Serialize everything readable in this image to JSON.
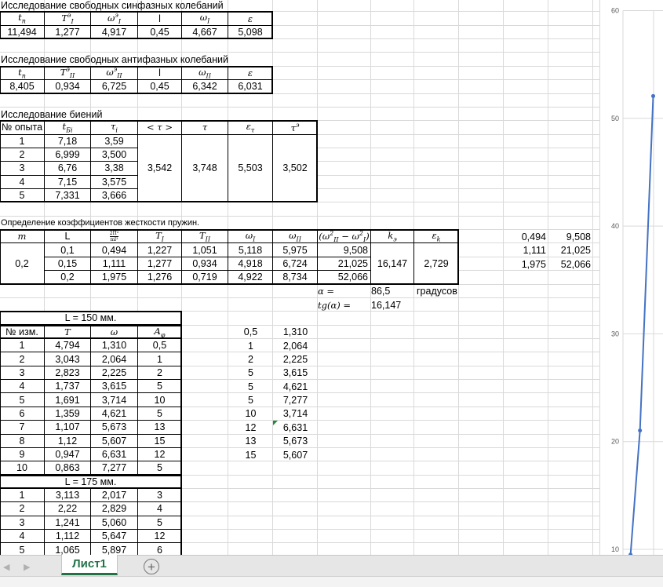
{
  "sync": {
    "title": "Исследование свободных синфазных колебаний",
    "headers": [
      {
        "t": "t",
        "sub": "n"
      },
      {
        "t": "T",
        "sub": "I",
        "sup": "э"
      },
      {
        "t": "ω",
        "sub": "I",
        "sup": "э"
      },
      {
        "plain": "l"
      },
      {
        "t": "ω",
        "sub": "I"
      },
      {
        "t": "ε"
      }
    ],
    "values": [
      "11,494",
      "1,277",
      "4,917",
      "0,45",
      "4,667",
      "5,098"
    ]
  },
  "anti": {
    "title": "Исследование свободных антифазных колебаний",
    "headers": [
      {
        "t": "t",
        "sub": "n"
      },
      {
        "t": "T",
        "sub": "II",
        "sup": "э"
      },
      {
        "t": "ω",
        "sub": "II",
        "sup": "э"
      },
      {
        "plain": "l"
      },
      {
        "t": "ω",
        "sub": "II"
      },
      {
        "t": "ε"
      }
    ],
    "values": [
      "8,405",
      "0,934",
      "6,725",
      "0,45",
      "6,342",
      "6,031"
    ]
  },
  "beats": {
    "title": "Исследование биений",
    "headers": [
      {
        "plain": "№ опыта"
      },
      {
        "t": "t",
        "sub": "Бi"
      },
      {
        "t": "τ",
        "sub": "i"
      },
      {
        "t": "< τ >"
      },
      {
        "t": "τ"
      },
      {
        "t": "ε",
        "sub": "τ"
      },
      {
        "t": "τ",
        "sup": "э"
      }
    ],
    "rows": [
      [
        "1",
        "7,18",
        "3,59"
      ],
      [
        "2",
        "6,999",
        "3,500"
      ],
      [
        "3",
        "6,76",
        "3,38"
      ],
      [
        "4",
        "7,15",
        "3,575"
      ],
      [
        "5",
        "7,331",
        "3,666"
      ]
    ],
    "summary": [
      "3,542",
      "3,748",
      "5,503",
      "3,502"
    ]
  },
  "stiffness": {
    "title": "Определение коэффициентов жесткости пружин.",
    "headers": [
      {
        "t": "m"
      },
      {
        "plain": "L"
      },
      {
        "num": "2Π²",
        "den": "ml²"
      },
      {
        "t": "T",
        "sub": "I"
      },
      {
        "t": "T",
        "sub": "II"
      },
      {
        "t": "ω",
        "sub": "I"
      },
      {
        "t": "ω",
        "sub": "II"
      },
      {
        "t": "(ω",
        "sup": "2",
        "sub": "II",
        "t2": " − ω",
        "sup2": "2",
        "sub2": "I",
        "t3": ")"
      },
      {
        "t": "k",
        "sub": "э"
      },
      {
        "t": "ε",
        "sub": "k"
      }
    ],
    "m": "0,2",
    "rows": [
      [
        "0,1",
        "0,494",
        "1,227",
        "1,051",
        "5,118",
        "5,975",
        "9,508"
      ],
      [
        "0,15",
        "1,111",
        "1,277",
        "0,934",
        "4,918",
        "6,724",
        "21,025"
      ],
      [
        "0,2",
        "1,975",
        "1,276",
        "0,719",
        "4,922",
        "8,734",
        "52,066"
      ]
    ],
    "k": "16,147",
    "eps_k": "2,729",
    "alpha_label": "α =",
    "alpha_value": "86,5",
    "alpha_unit": "градусов",
    "tg_label": "tg(α) =",
    "tg_value": "16,147",
    "side": [
      [
        "0,494",
        "9,508"
      ],
      [
        "1,111",
        "21,025"
      ],
      [
        "1,975",
        "52,066"
      ]
    ]
  },
  "l150": {
    "title": "L = 150 мм.",
    "headers": [
      {
        "plain": "№ изм."
      },
      {
        "t": "T"
      },
      {
        "t": "ω"
      },
      {
        "t": "A",
        "sub": "φ"
      }
    ],
    "rows": [
      [
        "1",
        "4,794",
        "1,310",
        "0,5"
      ],
      [
        "2",
        "3,043",
        "2,064",
        "1"
      ],
      [
        "3",
        "2,823",
        "2,225",
        "2"
      ],
      [
        "4",
        "1,737",
        "3,615",
        "5"
      ],
      [
        "5",
        "1,691",
        "3,714",
        "10"
      ],
      [
        "6",
        "1,359",
        "4,621",
        "5"
      ],
      [
        "7",
        "1,107",
        "5,673",
        "13"
      ],
      [
        "8",
        "1,12",
        "5,607",
        "15"
      ],
      [
        "9",
        "0,947",
        "6,631",
        "12"
      ],
      [
        "10",
        "0,863",
        "7,277",
        "5"
      ]
    ],
    "side": [
      [
        "0,5",
        "1,310"
      ],
      [
        "1",
        "2,064"
      ],
      [
        "2",
        "2,225"
      ],
      [
        "5",
        "3,615"
      ],
      [
        "5",
        "4,621"
      ],
      [
        "5",
        "7,277"
      ],
      [
        "10",
        "3,714"
      ],
      [
        "12",
        "6,631"
      ],
      [
        "13",
        "5,673"
      ],
      [
        "15",
        "5,607"
      ]
    ]
  },
  "l175": {
    "title": "L = 175 мм.",
    "rows": [
      [
        "1",
        "3,113",
        "2,017",
        "3"
      ],
      [
        "2",
        "2,22",
        "2,829",
        "4"
      ],
      [
        "3",
        "1,241",
        "5,060",
        "5"
      ],
      [
        "4",
        "1,112",
        "5,647",
        "12"
      ],
      [
        "5",
        "1,065",
        "5,897",
        "6"
      ]
    ]
  },
  "chart_data": {
    "type": "line",
    "title": "",
    "x": [
      0.494,
      1.111,
      1.975
    ],
    "series": [
      {
        "name": "ω²II − ω²I",
        "values": [
          9.508,
          21.025,
          52.066
        ],
        "color": "#4472c4"
      }
    ],
    "trendline": "dotted",
    "ylim": [
      10,
      60
    ],
    "yticks": [
      "10",
      "20",
      "30",
      "40",
      "50",
      "60"
    ],
    "xlim": [
      0,
      2.6
    ],
    "grid": true
  },
  "tabs": {
    "sheet1": "Лист1",
    "add": "+",
    "prev": "◀",
    "next": "▶"
  },
  "colors": {
    "accent": "#217346",
    "series": "#4472c4"
  }
}
